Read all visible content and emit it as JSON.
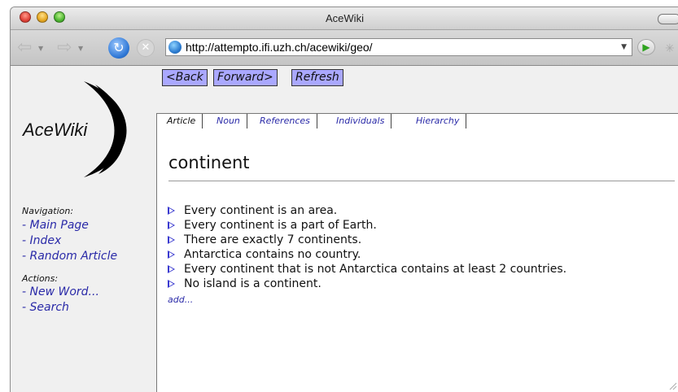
{
  "window": {
    "title": "AceWiki"
  },
  "browser": {
    "url": "http://attempto.ifi.uzh.ch/acewiki/geo/"
  },
  "logo": {
    "text": "AceWiki"
  },
  "sidebar": {
    "navigation_title": "Navigation:",
    "navigation": [
      "- Main Page",
      "- Index",
      "- Random Article"
    ],
    "actions_title": "Actions:",
    "actions": [
      "- New Word...",
      "- Search"
    ]
  },
  "nav_buttons": [
    "<Back",
    "Forward>",
    "Refresh"
  ],
  "tabs": [
    "Article",
    "Noun",
    "References",
    "Individuals",
    "Hierarchy"
  ],
  "article": {
    "title": "continent",
    "sentences": [
      "Every continent is an area.",
      "Every continent is a part of Earth.",
      "There are exactly 7 continents.",
      "Antarctica contains no country.",
      "Every continent that is not Antarctica contains at least 2 countries.",
      "No island is a continent."
    ],
    "add_label": "add..."
  },
  "colors": {
    "button_bg": "#aaa8ff",
    "link": "#2a2aa8",
    "sentence_marker": "#3a3ad0"
  }
}
